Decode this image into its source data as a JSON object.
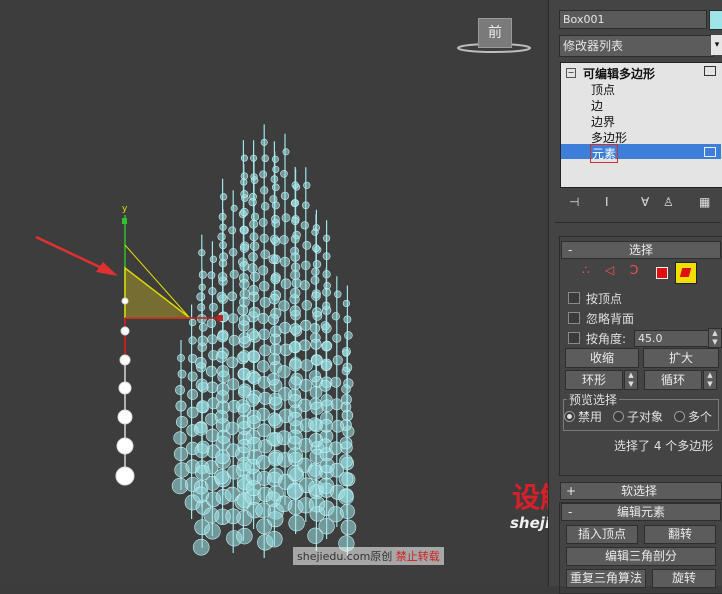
{
  "viewport": {
    "viewcube_label": "前",
    "axis_label": "y",
    "watermark_site": "shejiedu.com原创",
    "watermark_notice": "禁止转载",
    "brand_logo": "设解读",
    "brand_url": "shejiedu.com"
  },
  "panel": {
    "object_name": "Box001",
    "color_swatch": "#9fe4e8",
    "modifier_list": "修改器列表",
    "stack": {
      "root": "可编辑多边形",
      "items": [
        "顶点",
        "边",
        "边界",
        "多边形",
        "元素"
      ],
      "selected_index": 4
    },
    "selection": {
      "title": "选择",
      "collapse": "-",
      "by_vertex": "按顶点",
      "ignore_backfacing": "忽略背面",
      "by_angle": "按角度:",
      "angle_value": "45.0",
      "shrink": "收缩",
      "grow": "扩大",
      "ring": "环形",
      "loop": "循环",
      "preview_group": "预览选择",
      "preview_disabled": "禁用",
      "preview_subobject": "子对象",
      "preview_multi": "多个",
      "status": "选择了 4 个多边形"
    },
    "soft_selection": {
      "collapse": "+",
      "title": "软选择"
    },
    "edit_elements": {
      "collapse": "-",
      "title": "编辑元素",
      "insert_vertex": "插入顶点",
      "flip": "翻转",
      "edit_triangulation": "编辑三角剖分",
      "retriangulate": "重复三角算法",
      "turn": "旋转"
    }
  }
}
